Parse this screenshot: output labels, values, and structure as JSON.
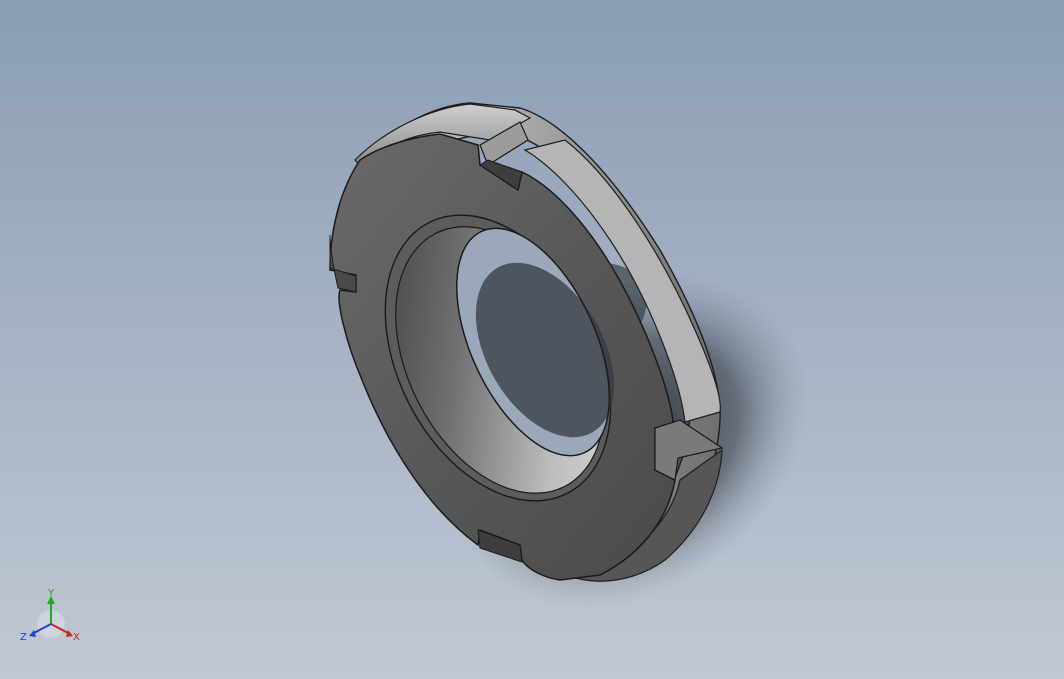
{
  "viewport": {
    "background_top": "#8a9db4",
    "background_bottom": "#c1c8d3",
    "model": "lock-nut-icon"
  },
  "triad": {
    "x_label": "X",
    "y_label": "Y",
    "z_label": "Z",
    "x_color": "#cc2222",
    "y_color": "#22aa22",
    "z_color": "#2244cc"
  }
}
